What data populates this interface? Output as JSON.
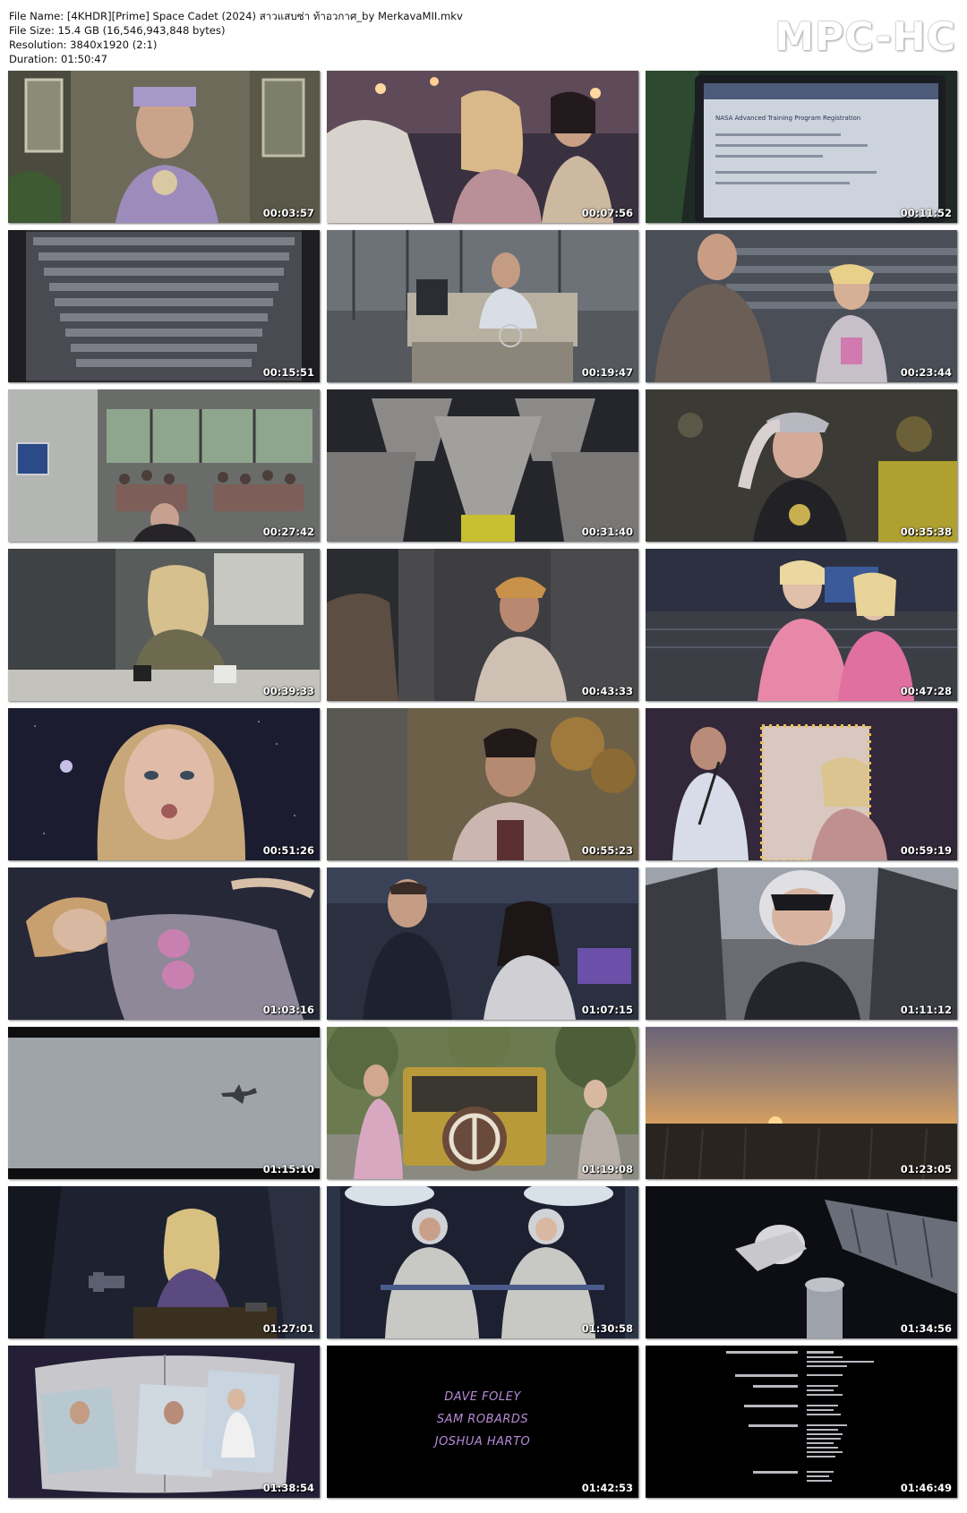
{
  "header": {
    "file_name_label": "File Name: [4KHDR][Prime] Space Cadet (2024) สาวแสบซ่า ท้าอวกาศ_by MerkavaMII.mkv",
    "file_size_label": "File Size: 15.4 GB (16,546,943,848 bytes)",
    "resolution_label": "Resolution: 3840x1920 (2:1)",
    "duration_label": "Duration: 01:50:47"
  },
  "brand": "MPC-HC",
  "thumbnails": [
    {
      "timestamp": "00:03:57"
    },
    {
      "timestamp": "00:07:56"
    },
    {
      "timestamp": "00:11:52",
      "screen_text": "NASA Advanced Training Program Registration"
    },
    {
      "timestamp": "00:15:51"
    },
    {
      "timestamp": "00:19:47"
    },
    {
      "timestamp": "00:23:44"
    },
    {
      "timestamp": "00:27:42"
    },
    {
      "timestamp": "00:31:40"
    },
    {
      "timestamp": "00:35:38"
    },
    {
      "timestamp": "00:39:33"
    },
    {
      "timestamp": "00:43:33"
    },
    {
      "timestamp": "00:47:28"
    },
    {
      "timestamp": "00:51:26"
    },
    {
      "timestamp": "00:55:23"
    },
    {
      "timestamp": "00:59:19"
    },
    {
      "timestamp": "01:03:16"
    },
    {
      "timestamp": "01:07:15"
    },
    {
      "timestamp": "01:11:12"
    },
    {
      "timestamp": "01:15:10"
    },
    {
      "timestamp": "01:19:08"
    },
    {
      "timestamp": "01:23:05"
    },
    {
      "timestamp": "01:27:01"
    },
    {
      "timestamp": "01:30:58"
    },
    {
      "timestamp": "01:34:56"
    },
    {
      "timestamp": "01:38:54"
    },
    {
      "timestamp": "01:42:53",
      "credits": [
        "DAVE FOLEY",
        "SAM ROBARDS",
        "JOSHUA HARTO"
      ]
    },
    {
      "timestamp": "01:46:49"
    }
  ],
  "colors": {
    "page_background": "#ffffff",
    "credit_text": "#b88ad8",
    "timestamp_text": "#ffffff"
  }
}
